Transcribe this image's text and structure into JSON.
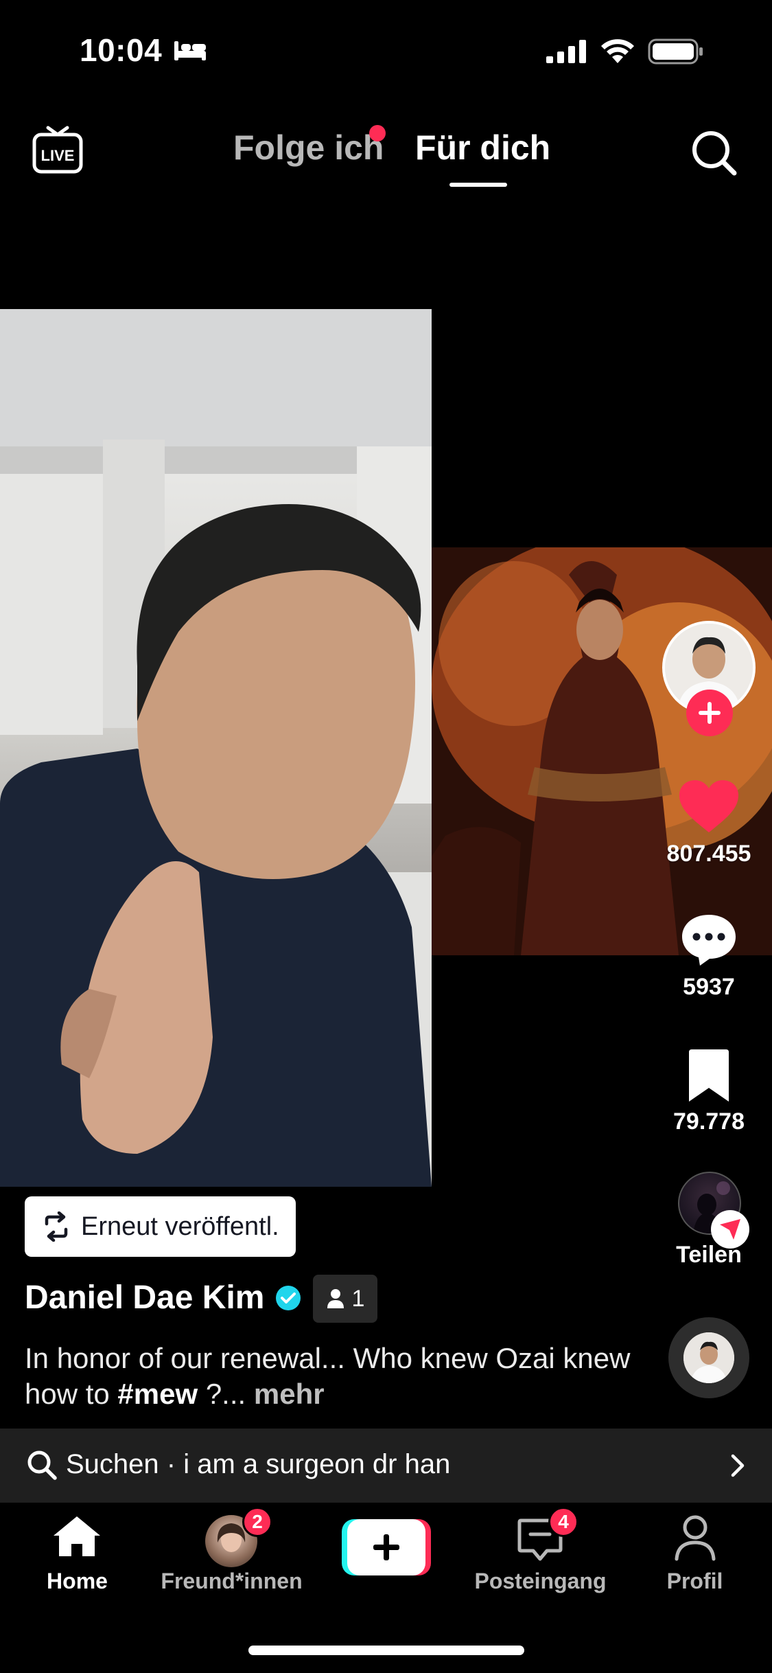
{
  "status_bar": {
    "time": "10:04"
  },
  "top_nav": {
    "tabs": [
      {
        "label": "Folge ich",
        "has_dot": true
      },
      {
        "label": "Für dich",
        "active": true
      }
    ]
  },
  "actions": {
    "likes": "807.455",
    "comments": "5937",
    "saves": "79.778",
    "share_label": "Teilen"
  },
  "post": {
    "repost_label": "Erneut veröffentl.",
    "author": "Daniel Dae Kim",
    "friends_count": "1",
    "caption_text": "In honor of our renewal... Who knew Ozai knew how to ",
    "hashtag": "#mew",
    "caption_tail": " ?...",
    "more_label": "mehr"
  },
  "search_suggestion": {
    "text": "Suchen · i am a surgeon dr han"
  },
  "tab_bar": {
    "items": [
      {
        "label": "Home",
        "active": true
      },
      {
        "label": "Freund*innen",
        "badge": "2"
      },
      {
        "label": ""
      },
      {
        "label": "Posteingang",
        "badge": "4"
      },
      {
        "label": "Profil"
      }
    ]
  },
  "colors": {
    "accent": "#fe2c55",
    "verified": "#20d5ec",
    "create_left": "#25f4ee"
  }
}
